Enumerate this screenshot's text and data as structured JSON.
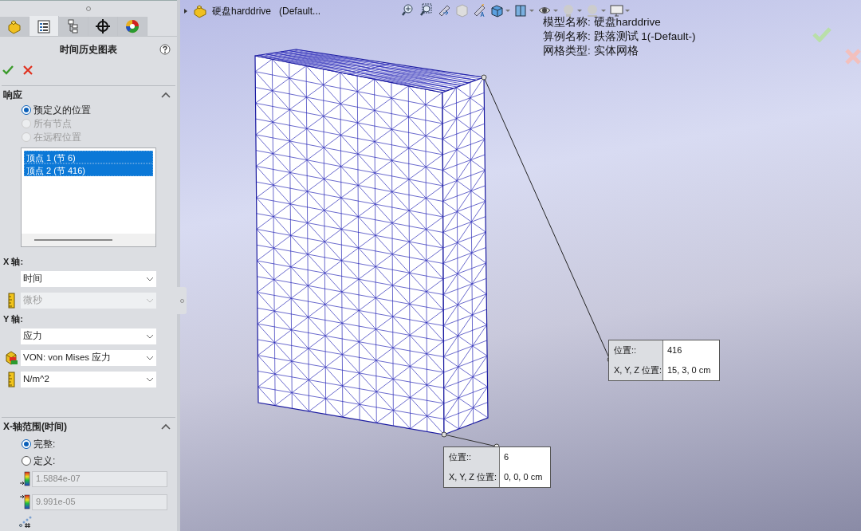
{
  "panel": {
    "tabs": [
      {
        "selected": false
      },
      {
        "selected": true
      },
      {
        "selected": false
      },
      {
        "selected": false
      },
      {
        "selected": false
      }
    ],
    "title": "时间历史图表",
    "response": {
      "title": "响应",
      "expanded": true,
      "options": [
        {
          "label": "预定义的位置",
          "selected": true,
          "disabled": false
        },
        {
          "label": "所有节点",
          "selected": false,
          "disabled": true
        },
        {
          "label": "在远程位置",
          "selected": false,
          "disabled": true
        }
      ],
      "points": [
        {
          "label": "顶点 1 (节 6)",
          "selected": true
        },
        {
          "label": "顶点 2 (节 416)",
          "selected": true
        }
      ]
    },
    "x_axis": {
      "label": "X 轴:",
      "fields": [
        {
          "value": "时间",
          "disabled": false,
          "kind": "plain"
        },
        {
          "value": "微秒",
          "disabled": true,
          "kind": "unit"
        }
      ]
    },
    "y_axis": {
      "label": "Y 轴:",
      "fields": [
        {
          "value": "应力",
          "disabled": false,
          "kind": "plain"
        },
        {
          "value": "VON: von Mises 应力",
          "disabled": false,
          "kind": "component"
        },
        {
          "value": "N/m^2",
          "disabled": false,
          "kind": "unit"
        }
      ]
    },
    "x_range": {
      "title": "X-轴范围(时间)",
      "expanded": true,
      "options": [
        {
          "label": "完整:",
          "selected": true
        },
        {
          "label": "定义:",
          "selected": false
        }
      ],
      "fields": [
        {
          "value": "1.5884e-07",
          "kind": "min",
          "disabled": true
        },
        {
          "value": "9.991e-05",
          "kind": "max",
          "disabled": true
        }
      ]
    }
  },
  "viewport": {
    "breadcrumb": {
      "name": "硬盘harddrive",
      "config": "(Default..."
    },
    "info": [
      "模型名称: 硬盘harddrive",
      "算例名称: 跌落测试 1(-Default-)",
      "网格类型: 实体网格"
    ],
    "callouts": [
      {
        "rows": [
          {
            "label": "位置::",
            "value": "416"
          },
          {
            "label": "X, Y, Z 位置:",
            "value": "15, 3, 0 cm"
          }
        ]
      },
      {
        "rows": [
          {
            "label": "位置::",
            "value": "6"
          },
          {
            "label": "X, Y, Z 位置:",
            "value": "0, 0, 0 cm"
          }
        ]
      }
    ]
  }
}
